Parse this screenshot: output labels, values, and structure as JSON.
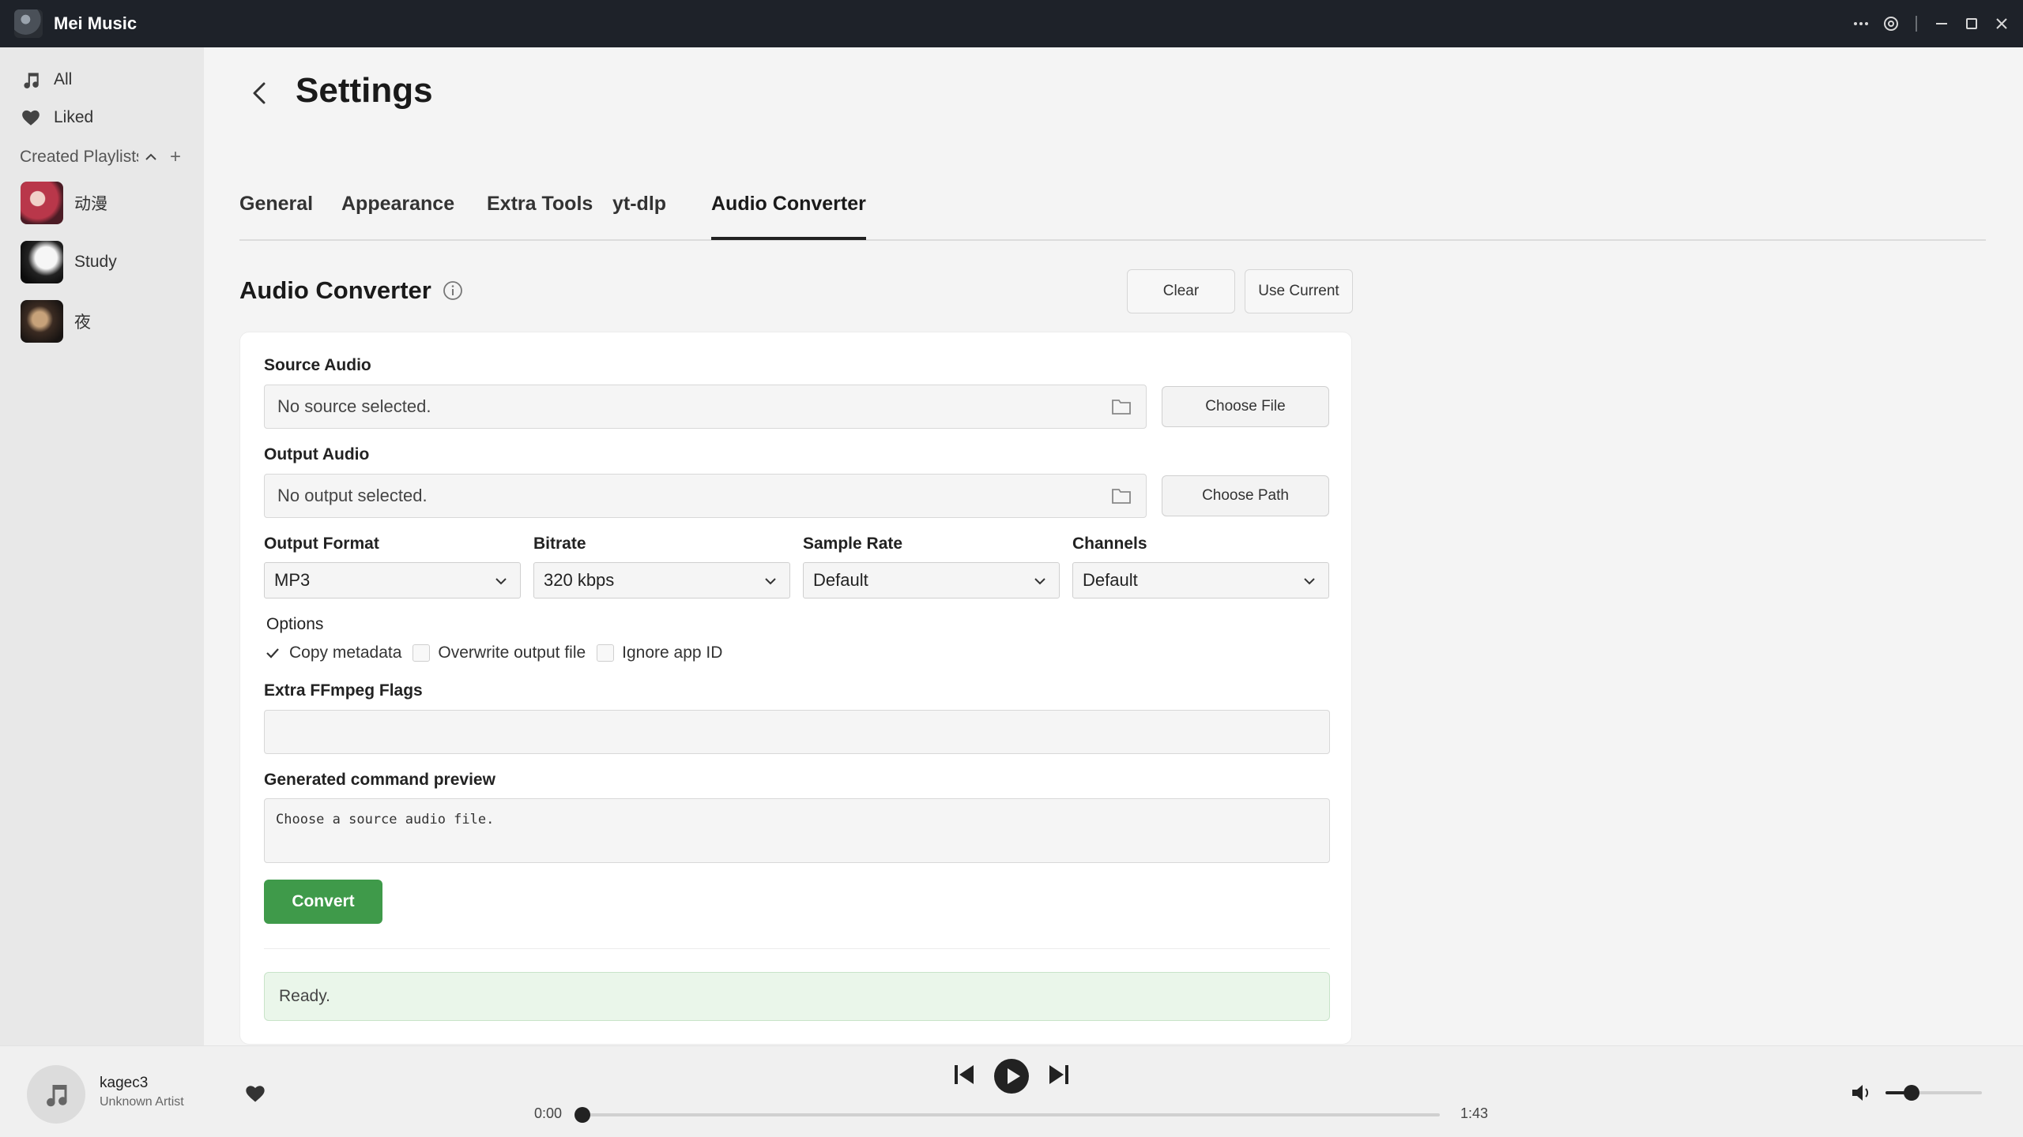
{
  "app": {
    "title": "Mei Music"
  },
  "sidebar": {
    "items": [
      {
        "label": "All",
        "icon": "music-note-icon"
      },
      {
        "label": "Liked",
        "icon": "heart-icon"
      }
    ],
    "section_label": "Created Playlists",
    "playlists": [
      {
        "label": "动漫"
      },
      {
        "label": "Study"
      },
      {
        "label": "夜"
      }
    ]
  },
  "page": {
    "title": "Settings",
    "tabs": [
      {
        "label": "General"
      },
      {
        "label": "Appearance"
      },
      {
        "label": "Extra Tools"
      },
      {
        "label": "yt-dlp"
      },
      {
        "label": "Audio Converter",
        "active": true
      }
    ]
  },
  "converter": {
    "title": "Audio Converter",
    "clear_label": "Clear",
    "use_current_label": "Use Current",
    "source_label": "Source Audio",
    "source_value": "No source selected.",
    "choose_file_label": "Choose File",
    "output_label": "Output Audio",
    "output_value": "No output selected.",
    "choose_path_label": "Choose Path",
    "format_label": "Output Format",
    "format_value": "MP3",
    "bitrate_label": "Bitrate",
    "bitrate_value": "320 kbps",
    "sample_rate_label": "Sample Rate",
    "sample_rate_value": "Default",
    "channels_label": "Channels",
    "channels_value": "Default",
    "options_label": "Options",
    "options": [
      {
        "label": "Copy metadata",
        "checked": true
      },
      {
        "label": "Overwrite output file",
        "checked": false
      },
      {
        "label": "Ignore app ID",
        "checked": false
      }
    ],
    "ffmpeg_flags_label": "Extra FFmpeg Flags",
    "ffmpeg_flags_value": "",
    "preview_label": "Generated command preview",
    "preview_value": "Choose a source audio file.",
    "convert_label": "Convert",
    "status": "Ready."
  },
  "player": {
    "title": "kagec3",
    "artist": "Unknown Artist",
    "current_time": "0:00",
    "duration": "1:43",
    "progress": 0,
    "volume": 0.27
  },
  "colors": {
    "accent_green": "#3f9a4a",
    "status_bg": "#eaf6ea",
    "titlebar_bg": "#1e2229"
  }
}
